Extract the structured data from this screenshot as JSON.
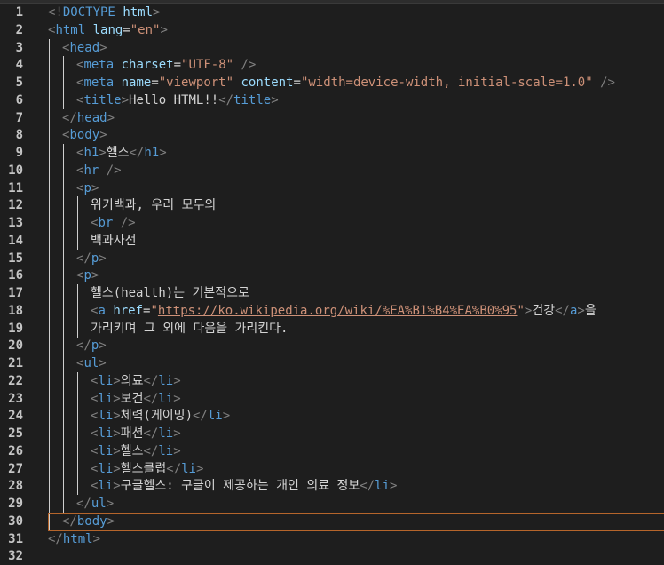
{
  "editor": {
    "active_line": 30,
    "lines": [
      {
        "n": "1",
        "indent": 0,
        "tokens": [
          [
            "p",
            "<!"
          ],
          [
            "tag",
            "DOCTYPE"
          ],
          [
            "txt",
            " "
          ],
          [
            "attr",
            "html"
          ],
          [
            "p",
            ">"
          ]
        ]
      },
      {
        "n": "2",
        "indent": 0,
        "tokens": [
          [
            "p",
            "<"
          ],
          [
            "tag",
            "html"
          ],
          [
            "txt",
            " "
          ],
          [
            "attr",
            "lang"
          ],
          [
            "txt",
            "="
          ],
          [
            "str",
            "\"en\""
          ],
          [
            "p",
            ">"
          ]
        ]
      },
      {
        "n": "3",
        "indent": 1,
        "tokens": [
          [
            "p",
            "<"
          ],
          [
            "tag",
            "head"
          ],
          [
            "p",
            ">"
          ]
        ]
      },
      {
        "n": "4",
        "indent": 2,
        "tokens": [
          [
            "p",
            "<"
          ],
          [
            "tag",
            "meta"
          ],
          [
            "txt",
            " "
          ],
          [
            "attr",
            "charset"
          ],
          [
            "txt",
            "="
          ],
          [
            "str",
            "\"UTF-8\""
          ],
          [
            "txt",
            " "
          ],
          [
            "p",
            "/>"
          ]
        ]
      },
      {
        "n": "5",
        "indent": 2,
        "tokens": [
          [
            "p",
            "<"
          ],
          [
            "tag",
            "meta"
          ],
          [
            "txt",
            " "
          ],
          [
            "attr",
            "name"
          ],
          [
            "txt",
            "="
          ],
          [
            "str",
            "\"viewport\""
          ],
          [
            "txt",
            " "
          ],
          [
            "attr",
            "content"
          ],
          [
            "txt",
            "="
          ],
          [
            "str",
            "\"width=device-width, initial-scale=1.0\""
          ],
          [
            "txt",
            " "
          ],
          [
            "p",
            "/>"
          ]
        ]
      },
      {
        "n": "6",
        "indent": 2,
        "tokens": [
          [
            "p",
            "<"
          ],
          [
            "tag",
            "title"
          ],
          [
            "p",
            ">"
          ],
          [
            "txt",
            "Hello HTML!!"
          ],
          [
            "p",
            "</"
          ],
          [
            "tag",
            "title"
          ],
          [
            "p",
            ">"
          ]
        ]
      },
      {
        "n": "7",
        "indent": 1,
        "tokens": [
          [
            "p",
            "</"
          ],
          [
            "tag",
            "head"
          ],
          [
            "p",
            ">"
          ]
        ]
      },
      {
        "n": "8",
        "indent": 1,
        "tokens": [
          [
            "p",
            "<"
          ],
          [
            "tag",
            "body"
          ],
          [
            "p",
            ">"
          ]
        ]
      },
      {
        "n": "9",
        "indent": 2,
        "tokens": [
          [
            "p",
            "<"
          ],
          [
            "tag",
            "h1"
          ],
          [
            "p",
            ">"
          ],
          [
            "txt",
            "헬스"
          ],
          [
            "p",
            "</"
          ],
          [
            "tag",
            "h1"
          ],
          [
            "p",
            ">"
          ]
        ]
      },
      {
        "n": "10",
        "indent": 2,
        "tokens": [
          [
            "p",
            "<"
          ],
          [
            "tag",
            "hr"
          ],
          [
            "txt",
            " "
          ],
          [
            "p",
            "/>"
          ]
        ]
      },
      {
        "n": "11",
        "indent": 2,
        "tokens": [
          [
            "p",
            "<"
          ],
          [
            "tag",
            "p"
          ],
          [
            "p",
            ">"
          ]
        ]
      },
      {
        "n": "12",
        "indent": 3,
        "tokens": [
          [
            "txt",
            "위키백과, 우리 모두의"
          ]
        ]
      },
      {
        "n": "13",
        "indent": 3,
        "tokens": [
          [
            "p",
            "<"
          ],
          [
            "tag",
            "br"
          ],
          [
            "txt",
            " "
          ],
          [
            "p",
            "/>"
          ]
        ]
      },
      {
        "n": "14",
        "indent": 3,
        "tokens": [
          [
            "txt",
            "백과사전"
          ]
        ]
      },
      {
        "n": "15",
        "indent": 2,
        "tokens": [
          [
            "p",
            "</"
          ],
          [
            "tag",
            "p"
          ],
          [
            "p",
            ">"
          ]
        ]
      },
      {
        "n": "16",
        "indent": 2,
        "tokens": [
          [
            "p",
            "<"
          ],
          [
            "tag",
            "p"
          ],
          [
            "p",
            ">"
          ]
        ]
      },
      {
        "n": "17",
        "indent": 3,
        "tokens": [
          [
            "txt",
            "헬스(health)는 기본적으로"
          ]
        ]
      },
      {
        "n": "18",
        "indent": 3,
        "tokens": [
          [
            "p",
            "<"
          ],
          [
            "tag",
            "a"
          ],
          [
            "txt",
            " "
          ],
          [
            "attr",
            "href"
          ],
          [
            "txt",
            "="
          ],
          [
            "str",
            "\""
          ],
          [
            "link",
            "https://ko.wikipedia.org/wiki/%EA%B1%B4%EA%B0%95"
          ],
          [
            "str",
            "\""
          ],
          [
            "p",
            ">"
          ],
          [
            "txt",
            "건강"
          ],
          [
            "p",
            "</"
          ],
          [
            "tag",
            "a"
          ],
          [
            "p",
            ">"
          ],
          [
            "txt",
            "을"
          ]
        ]
      },
      {
        "n": "19",
        "indent": 3,
        "tokens": [
          [
            "txt",
            "가리키며 그 외에 다음을 가리킨다."
          ]
        ]
      },
      {
        "n": "20",
        "indent": 2,
        "tokens": [
          [
            "p",
            "</"
          ],
          [
            "tag",
            "p"
          ],
          [
            "p",
            ">"
          ]
        ]
      },
      {
        "n": "21",
        "indent": 2,
        "tokens": [
          [
            "p",
            "<"
          ],
          [
            "tag",
            "ul"
          ],
          [
            "p",
            ">"
          ]
        ]
      },
      {
        "n": "22",
        "indent": 3,
        "tokens": [
          [
            "p",
            "<"
          ],
          [
            "tag",
            "li"
          ],
          [
            "p",
            ">"
          ],
          [
            "txt",
            "의료"
          ],
          [
            "p",
            "</"
          ],
          [
            "tag",
            "li"
          ],
          [
            "p",
            ">"
          ]
        ]
      },
      {
        "n": "23",
        "indent": 3,
        "tokens": [
          [
            "p",
            "<"
          ],
          [
            "tag",
            "li"
          ],
          [
            "p",
            ">"
          ],
          [
            "txt",
            "보건"
          ],
          [
            "p",
            "</"
          ],
          [
            "tag",
            "li"
          ],
          [
            "p",
            ">"
          ]
        ]
      },
      {
        "n": "24",
        "indent": 3,
        "tokens": [
          [
            "p",
            "<"
          ],
          [
            "tag",
            "li"
          ],
          [
            "p",
            ">"
          ],
          [
            "txt",
            "체력(게이밍)"
          ],
          [
            "p",
            "</"
          ],
          [
            "tag",
            "li"
          ],
          [
            "p",
            ">"
          ]
        ]
      },
      {
        "n": "25",
        "indent": 3,
        "tokens": [
          [
            "p",
            "<"
          ],
          [
            "tag",
            "li"
          ],
          [
            "p",
            ">"
          ],
          [
            "txt",
            "패션"
          ],
          [
            "p",
            "</"
          ],
          [
            "tag",
            "li"
          ],
          [
            "p",
            ">"
          ]
        ]
      },
      {
        "n": "26",
        "indent": 3,
        "tokens": [
          [
            "p",
            "<"
          ],
          [
            "tag",
            "li"
          ],
          [
            "p",
            ">"
          ],
          [
            "txt",
            "헬스"
          ],
          [
            "p",
            "</"
          ],
          [
            "tag",
            "li"
          ],
          [
            "p",
            ">"
          ]
        ]
      },
      {
        "n": "27",
        "indent": 3,
        "tokens": [
          [
            "p",
            "<"
          ],
          [
            "tag",
            "li"
          ],
          [
            "p",
            ">"
          ],
          [
            "txt",
            "헬스클럽"
          ],
          [
            "p",
            "</"
          ],
          [
            "tag",
            "li"
          ],
          [
            "p",
            ">"
          ]
        ]
      },
      {
        "n": "28",
        "indent": 3,
        "tokens": [
          [
            "p",
            "<"
          ],
          [
            "tag",
            "li"
          ],
          [
            "p",
            ">"
          ],
          [
            "txt",
            "구글헬스: 구글이 제공하는 개인 의료 정보"
          ],
          [
            "p",
            "</"
          ],
          [
            "tag",
            "li"
          ],
          [
            "p",
            ">"
          ]
        ]
      },
      {
        "n": "29",
        "indent": 2,
        "tokens": [
          [
            "p",
            "</"
          ],
          [
            "tag",
            "ul"
          ],
          [
            "p",
            ">"
          ]
        ]
      },
      {
        "n": "30",
        "indent": 1,
        "tokens": [
          [
            "p",
            "</"
          ],
          [
            "tag",
            "body"
          ],
          [
            "p",
            ">"
          ]
        ]
      },
      {
        "n": "31",
        "indent": 0,
        "tokens": [
          [
            "p",
            "</"
          ],
          [
            "tag",
            "html"
          ],
          [
            "p",
            ">"
          ]
        ]
      },
      {
        "n": "32",
        "indent": 0,
        "tokens": []
      }
    ]
  }
}
